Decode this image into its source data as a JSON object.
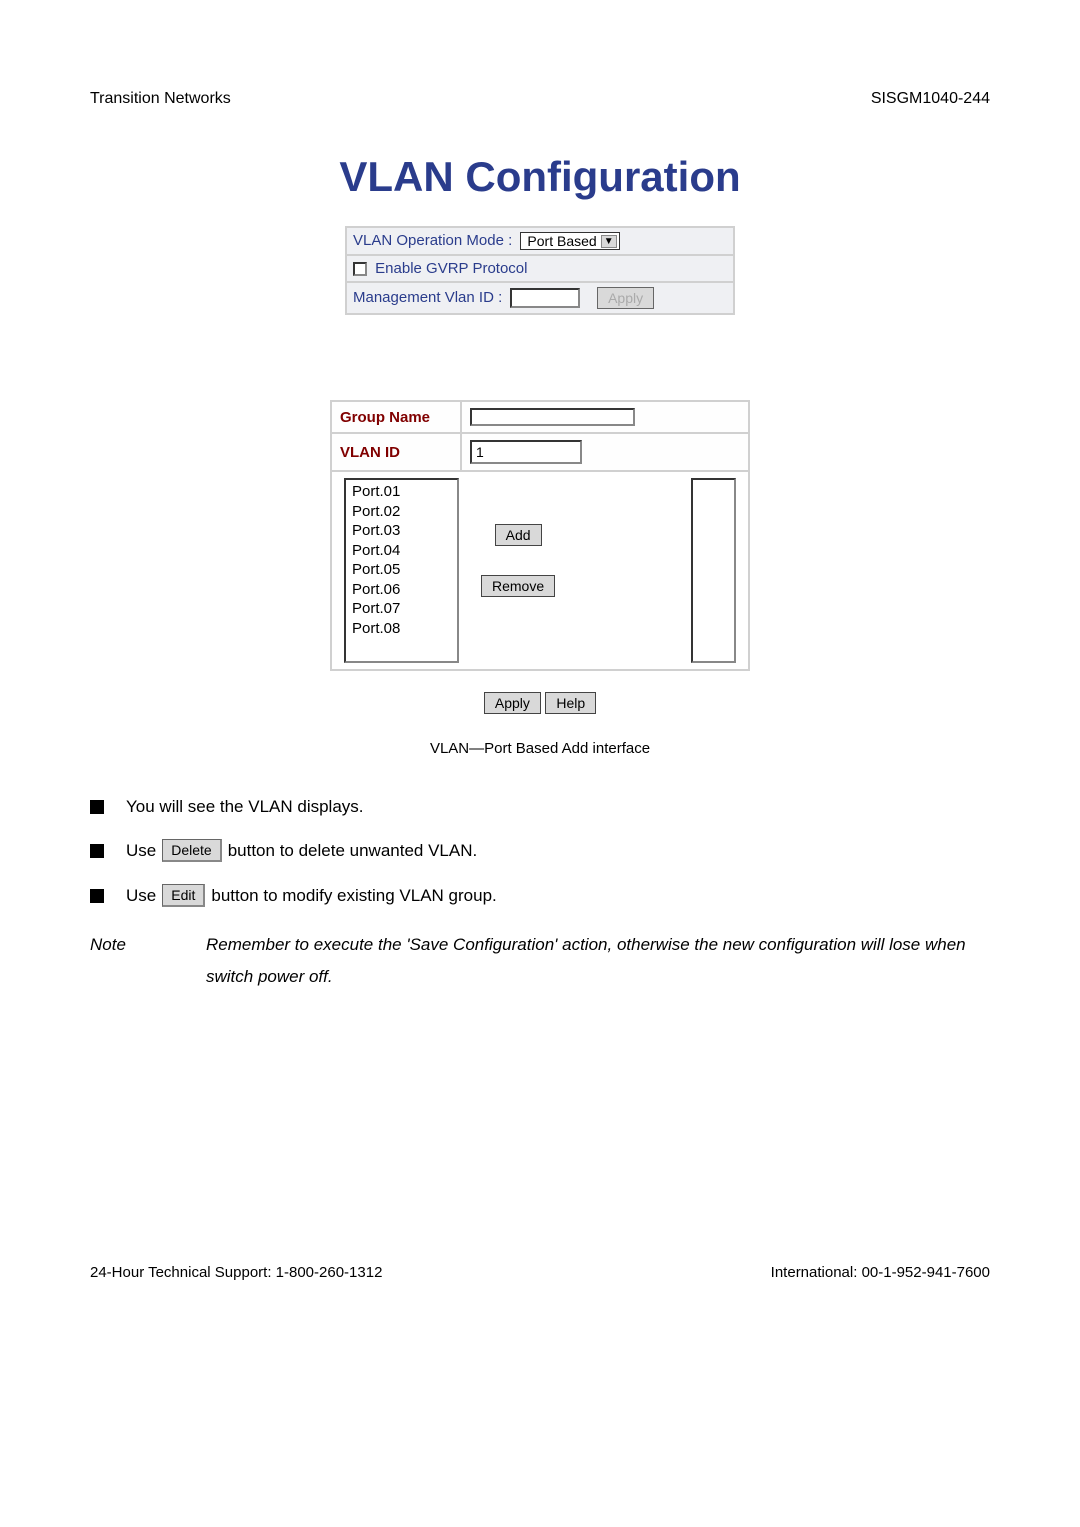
{
  "header": {
    "left": "Transition Networks",
    "right": "SISGM1040-244"
  },
  "title": "VLAN Configuration",
  "config": {
    "modeLabel": "VLAN Operation Mode : ",
    "modeValue": "Port Based",
    "gvrpLabel": " Enable GVRP Protocol",
    "mgmtLabel": "Management Vlan ID : ",
    "applyLabel": "Apply"
  },
  "groupTable": {
    "groupNameLabel": "Group Name",
    "groupNameValue": "",
    "vlanIdLabel": "VLAN ID",
    "vlanIdValue": "1",
    "ports": [
      "Port.01",
      "Port.02",
      "Port.03",
      "Port.04",
      "Port.05",
      "Port.06",
      "Port.07",
      "Port.08"
    ],
    "addLabel": "Add",
    "removeLabel": "Remove"
  },
  "bottomButtons": {
    "apply": "Apply",
    "help": "Help"
  },
  "caption": "VLAN—Port Based Add interface",
  "bullets": {
    "b1": "You will see the VLAN displays.",
    "b2a": "Use ",
    "b2btn": "Delete",
    "b2b": " button to delete unwanted VLAN.",
    "b3a": "Use ",
    "b3btn": "Edit",
    "b3b": " button to modify existing VLAN group."
  },
  "note": {
    "label": "Note",
    "text": "Remember to execute the 'Save Configuration' action, otherwise the new configuration will lose when switch power off."
  },
  "footer": {
    "left": "24-Hour Technical Support: 1-800-260-1312",
    "right": "International: 00-1-952-941-7600"
  }
}
